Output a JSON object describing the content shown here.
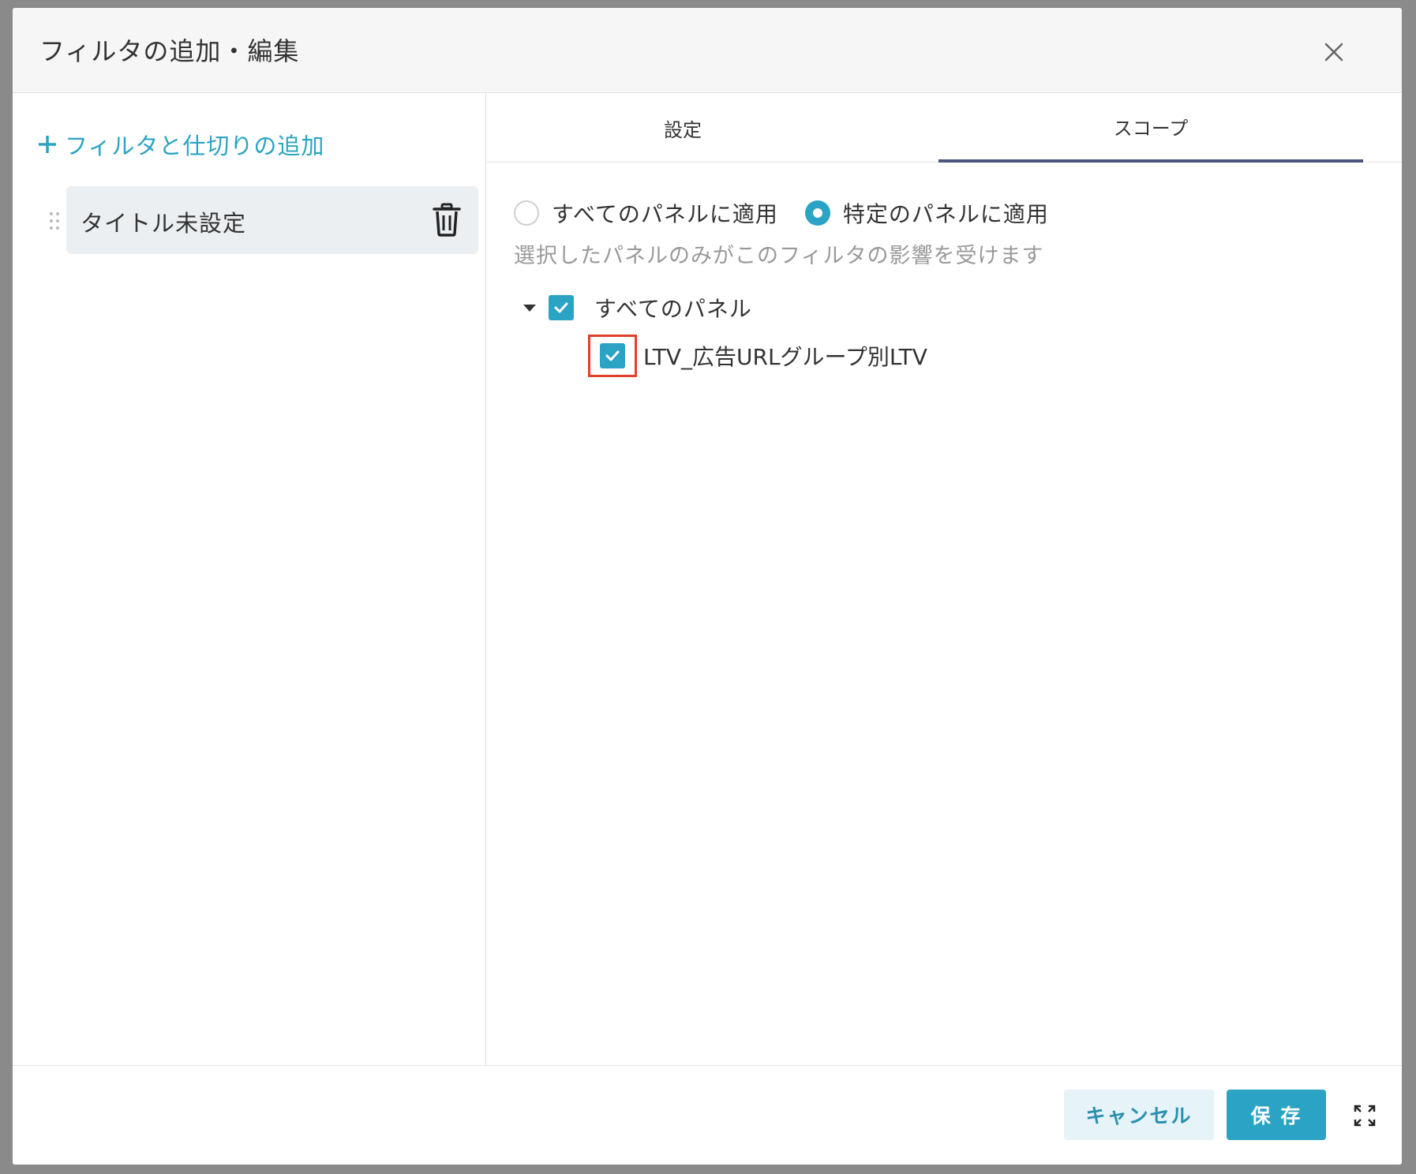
{
  "dialog": {
    "title": "フィルタの追加・編集"
  },
  "sidebar": {
    "add_label": "フィルタと仕切りの追加",
    "items": [
      {
        "label": "タイトル未設定"
      }
    ]
  },
  "tabs": [
    {
      "label": "設定",
      "active": false
    },
    {
      "label": "スコープ",
      "active": true
    }
  ],
  "scope": {
    "options": [
      {
        "label": "すべてのパネルに適用",
        "selected": false
      },
      {
        "label": "特定のパネルに適用",
        "selected": true
      }
    ],
    "description": "選択したパネルのみがこのフィルタの影響を受けます",
    "tree": {
      "root_label": "すべてのパネル",
      "root_checked": true,
      "children": [
        {
          "label": "LTV_広告URLグループ別LTV",
          "checked": true
        }
      ]
    }
  },
  "footer": {
    "cancel_label": "キャンセル",
    "save_label": "保 存"
  },
  "colors": {
    "accent": "#2ba3c4",
    "tab_underline": "#4b5580",
    "highlight": "#e0412a"
  }
}
